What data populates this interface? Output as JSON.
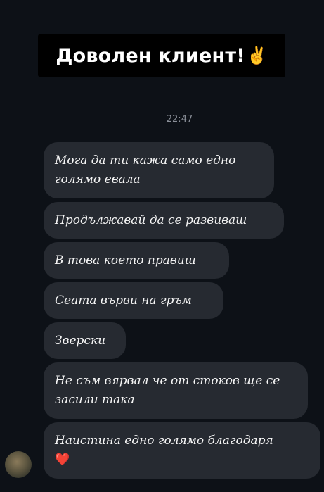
{
  "banner": {
    "title": "Доволен клиент!",
    "emoji": "✌️"
  },
  "chat": {
    "timestamp": "22:47",
    "messages": [
      {
        "text": "Мога да ти кажа само едно голямо евала"
      },
      {
        "text": "Продължавай да се развиваш"
      },
      {
        "text": "В това което правиш"
      },
      {
        "text": "Сеата върви на гръм"
      },
      {
        "text": "Зверски"
      },
      {
        "text": "Не съм вярвал че от стоков ще се засили така"
      },
      {
        "text": "Наистина едно голямо благодаря",
        "emoji": "❤️"
      }
    ]
  }
}
